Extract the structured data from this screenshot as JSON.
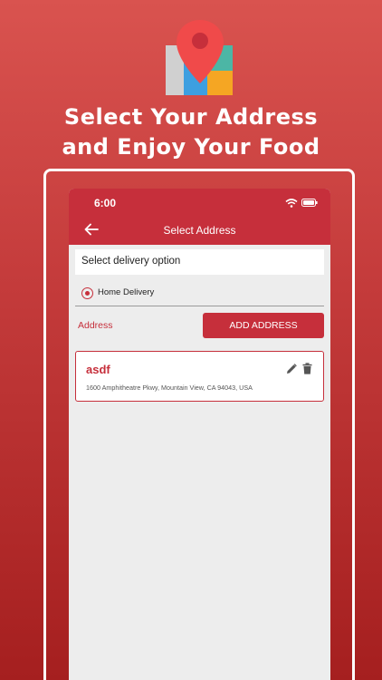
{
  "header": {
    "line1": "Select Your Address",
    "line2": "and Enjoy Your Food"
  },
  "status_bar": {
    "time": "6:00"
  },
  "app_bar": {
    "title": "Select Address"
  },
  "delivery_option": {
    "prompt": "Select delivery option",
    "selected": "Home Delivery"
  },
  "address_section": {
    "label": "Address",
    "add_button_label": "ADD ADDRESS"
  },
  "addresses": [
    {
      "name": "asdf",
      "address": "1600 Amphitheatre Pkwy, Mountain View, CA 94043, USA"
    }
  ],
  "icons": [
    "map-pin-icon",
    "wifi-icon",
    "battery-icon",
    "back-arrow-icon",
    "radio-selected-icon",
    "edit-icon",
    "delete-icon"
  ],
  "colors": {
    "brand_red": "#c62f3b",
    "background_top": "#d9534f",
    "background_bottom": "#a51f1f",
    "screen_bg": "#ededed"
  }
}
